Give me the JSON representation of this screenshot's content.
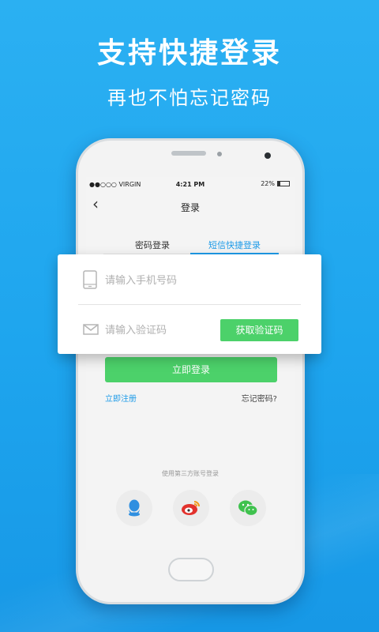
{
  "promo": {
    "headline": "支持快捷登录",
    "subline": "再也不怕忘记密码"
  },
  "statusbar": {
    "carrier": "●●○○○ VIRGIN",
    "time": "4:21 PM",
    "battery": "22%"
  },
  "nav": {
    "back_icon": "chevron-left-icon",
    "back_glyph": "‹",
    "title": "登录"
  },
  "tabs": [
    {
      "label": "密码登录",
      "active": false
    },
    {
      "label": "短信快捷登录",
      "active": true
    }
  ],
  "form": {
    "phone_placeholder": "请输入手机号码",
    "code_placeholder": "请输入验证码",
    "get_code_label": "获取验证码"
  },
  "actions": {
    "login_label": "立即登录",
    "register_label": "立即注册",
    "forgot_label": "忘记密码?"
  },
  "third_party": {
    "label": "使用第三方账号登录",
    "providers": [
      "qq-icon",
      "weibo-icon",
      "wechat-icon"
    ]
  },
  "colors": {
    "background": "#22a8f0",
    "accent_green": "#4cd16a",
    "accent_blue": "#1e9be8",
    "qq": "#2f8fe0",
    "weibo": "#e2322d",
    "wechat": "#3fc24e"
  }
}
